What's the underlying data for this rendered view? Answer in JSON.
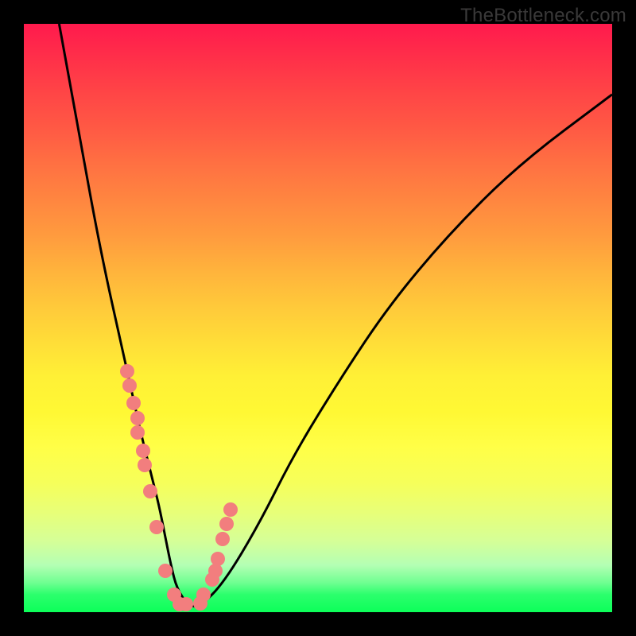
{
  "watermark": "TheBottleneck.com",
  "chart_data": {
    "type": "line",
    "title": "",
    "xlabel": "",
    "ylabel": "",
    "xlim": [
      0,
      100
    ],
    "ylim": [
      0,
      100
    ],
    "grid": false,
    "legend": false,
    "series": [
      {
        "name": "bottleneck-curve",
        "x": [
          6,
          8,
          10,
          12,
          14,
          16,
          18,
          20,
          21,
          22,
          23,
          24,
          25,
          26,
          28,
          30,
          34,
          40,
          46,
          54,
          62,
          72,
          84,
          100
        ],
        "y": [
          100,
          89,
          78,
          67,
          57,
          48,
          39,
          30,
          26,
          22,
          18,
          13,
          8,
          4,
          1,
          1,
          5,
          15,
          27,
          40,
          52,
          64,
          76,
          88
        ]
      }
    ],
    "points": {
      "name": "left-cluster-and-right-cluster",
      "x": [
        17.5,
        18.0,
        18.7,
        19.3,
        19.3,
        20.3,
        20.6,
        21.5,
        22.5,
        24.0,
        25.5,
        26.5,
        27.5,
        30.0,
        30.6,
        32.0,
        32.5,
        33.0,
        33.8,
        34.5,
        35.2
      ],
      "y": [
        41.0,
        38.5,
        35.5,
        33.0,
        30.5,
        27.5,
        25.0,
        20.5,
        14.5,
        7.0,
        3.0,
        1.3,
        1.3,
        1.5,
        3.0,
        5.5,
        7.0,
        9.0,
        12.5,
        15.0,
        17.5
      ]
    },
    "background_gradient": {
      "top": "#ff1a4d",
      "mid": "#ffff47",
      "bottom": "#0cff59"
    }
  }
}
